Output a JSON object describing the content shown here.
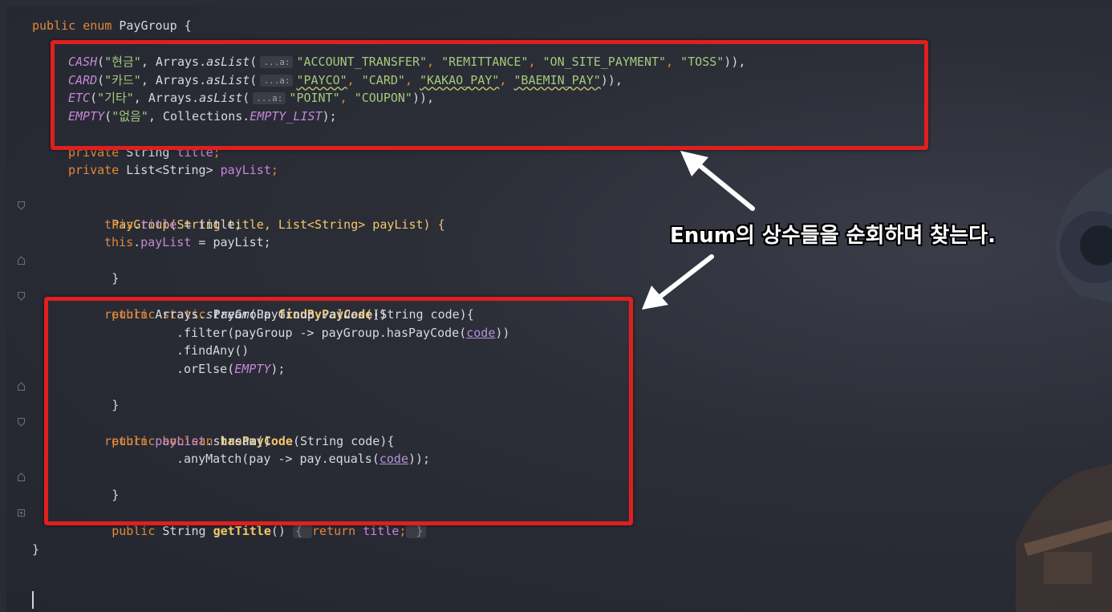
{
  "editor": {
    "enum_header": [
      "public",
      " enum ",
      "PayGroup {"
    ],
    "constants": [
      {
        "name": "CASH",
        "label": "\"현금\"",
        "call": ", Arrays.",
        "method": "asList",
        "open": "(",
        "hint": "...a:",
        "args": [
          "\"ACCOUNT_TRANSFER\"",
          ", ",
          "\"REMITTANCE\"",
          ", ",
          "\"ON_SITE_PAYMENT\"",
          ", ",
          "\"TOSS\""
        ],
        "close": ")),"
      },
      {
        "name": "CARD",
        "label": "\"카드\"",
        "call": ", Arrays.",
        "method": "asList",
        "open": "(",
        "hint": "...a:",
        "args": [
          "\"PAYCO\"",
          ", ",
          "\"CARD\"",
          ", ",
          "\"KAKAO_PAY\"",
          ", ",
          "\"BAEMIN_PAY\""
        ],
        "close": ")),"
      },
      {
        "name": "ETC",
        "label": "\"기타\"",
        "call": ", Arrays.",
        "method": "asList",
        "open": "(",
        "hint": "...a:",
        "args": [
          "\"POINT\"",
          ", ",
          "\"COUPON\""
        ],
        "close": ")),"
      },
      {
        "name": "EMPTY",
        "label": "\"없음\"",
        "call": ", Collections.",
        "method": "EMPTY_LIST",
        "close": ");"
      }
    ],
    "fields": [
      {
        "mod": "private",
        "type": " String ",
        "name": "title",
        "end": ";"
      },
      {
        "mod": "private",
        "type": " List<String> ",
        "name": "payList",
        "end": ";"
      }
    ],
    "ctor": {
      "sig": "PayGroup(String title, List<String> payList) {",
      "l1_this": "this",
      ".": ".",
      "l1_field": "title",
      "l1_rest": " = title;",
      "l2_this": "this",
      "l2_field": "payList",
      "l2_rest": " = payList;",
      "close": "}"
    },
    "find": {
      "mod": "public static",
      "type": " PayGroup ",
      "name": "findByPayCode",
      "params": "(String code){",
      "ret": "return",
      "stream_a": " Arrays.",
      "stream_m": "stream",
      "stream_b": "(PayGroup.",
      "values": "values",
      "stream_c": "())",
      "filter_a": ".filter(payGroup -> payGroup.hasPayCode(",
      "code": "code",
      "filter_b": "))",
      "findany": ".findAny()",
      "orelse_a": ".orElse(",
      "orelse_v": "EMPTY",
      "orelse_b": ");",
      "close": "}"
    },
    "has": {
      "mod": "public boolean",
      "name": " hasPayCode",
      "params": "(String code){",
      "ret": "return",
      "field": " payList",
      "rest": ".stream()",
      "match_a": ".anyMatch(pay -> pay.equals(",
      "code": "code",
      "match_b": "));",
      "close": "}"
    },
    "getter": {
      "mod": "public",
      "type": " String ",
      "name": "getTitle",
      "parens": "() ",
      "body_open": "{ ",
      "ret": "return",
      "field": " title",
      "semi": ";",
      "body_close": " }"
    },
    "end": "}"
  },
  "callout": {
    "text": "Enum의 상수들을 순회하며 찾는다."
  },
  "colors": {
    "keyword": "#e0883a",
    "field": "#c587d6",
    "string": "#a3cb7c",
    "method": "#f1c865",
    "highlight": "#e01f1f",
    "background": "#2b2d37"
  }
}
